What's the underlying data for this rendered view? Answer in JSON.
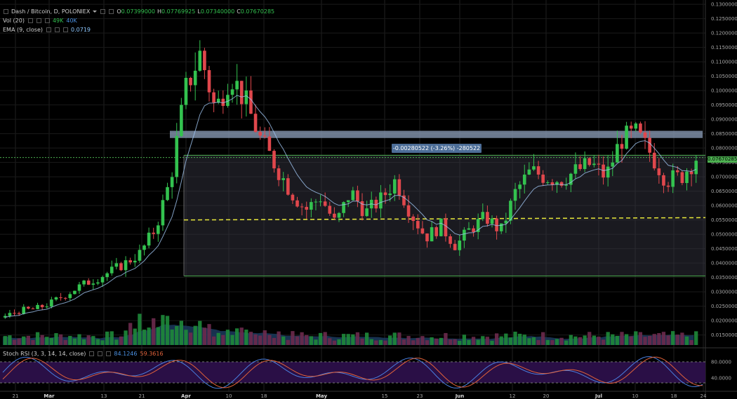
{
  "header": {
    "symbol": "Dash / Bitcoin, D, POLONIEX",
    "ohlc": [
      {
        "k": "O",
        "v": "0.07399000"
      },
      {
        "k": "H",
        "v": "0.07769925"
      },
      {
        "k": "L",
        "v": "0.07340000"
      },
      {
        "k": "C",
        "v": "0.07670285"
      }
    ]
  },
  "indicators": {
    "vol": {
      "label": "Vol (20)",
      "v1": "49K",
      "v2": "40K",
      "v1_color": "#33c24f",
      "v2_color": "#4a90e2"
    },
    "ema": {
      "label": "EMA (9, close)",
      "value": "0.0719"
    },
    "stoch": {
      "label": "Stoch RSI (3, 3, 14, 14, close)",
      "k": "84.1246",
      "d": "59.3616"
    }
  },
  "price_axis": {
    "labels": [
      "0.13000000",
      "0.12500000",
      "0.12000000",
      "0.11500000",
      "0.11000000",
      "0.10500000",
      "0.10000000",
      "0.09500000",
      "0.09000000",
      "0.08500000",
      "0.08000000",
      "0.07500000",
      "0.07000000",
      "0.06500000",
      "0.06000000",
      "0.05500000",
      "0.05000000",
      "0.04500000",
      "0.04000000",
      "0.03500000",
      "0.03000000",
      "0.02500000",
      "0.02000000",
      "0.01500000"
    ],
    "current_price": "0.07670285"
  },
  "rsi_axis": {
    "labels": [
      "80.0000",
      "40.0000"
    ]
  },
  "time_axis": {
    "labels": [
      {
        "t": "21",
        "bold": false
      },
      {
        "t": "Mar",
        "bold": true
      },
      {
        "t": "13",
        "bold": false
      },
      {
        "t": "21",
        "bold": false
      },
      {
        "t": "Apr",
        "bold": true
      },
      {
        "t": "10",
        "bold": false
      },
      {
        "t": "18",
        "bold": false
      },
      {
        "t": "May",
        "bold": true
      },
      {
        "t": "15",
        "bold": false
      },
      {
        "t": "23",
        "bold": false
      },
      {
        "t": "Jun",
        "bold": true
      },
      {
        "t": "12",
        "bold": false
      },
      {
        "t": "20",
        "bold": false
      },
      {
        "t": "Jul",
        "bold": true
      },
      {
        "t": "10",
        "bold": false
      },
      {
        "t": "18",
        "bold": false
      },
      {
        "t": "24",
        "bold": false
      }
    ]
  },
  "measurement": {
    "text": "-0.00280522 (-3.26%) -280522"
  },
  "colors": {
    "up": "#33c24f",
    "down": "#e0474c",
    "ema": "#9fc4f0",
    "rsi_k": "#4a7fe0",
    "rsi_d": "#e2623a",
    "rsi_band": "#2a0f46",
    "support": "#e8e83a",
    "box": "#4caf50"
  },
  "chart_data": {
    "type": "candlestick",
    "instrument": "Dash / Bitcoin, D, POLONIEX",
    "ylim": [
      0.012,
      0.131
    ],
    "close_path": [
      0.0215,
      0.0235,
      0.024,
      0.026,
      0.029,
      0.032,
      0.0345,
      0.037,
      0.04,
      0.0435,
      0.052,
      0.069,
      0.1,
      0.113,
      0.093,
      0.106,
      0.096,
      0.083,
      0.074,
      0.065,
      0.0585,
      0.063,
      0.0535,
      0.065,
      0.0575,
      0.062,
      0.069,
      0.0575,
      0.049,
      0.053,
      0.046,
      0.052,
      0.056,
      0.051,
      0.065,
      0.072,
      0.07,
      0.069,
      0.072,
      0.0745,
      0.07,
      0.083,
      0.085,
      0.078,
      0.069,
      0.07,
      0.0767
    ],
    "resistance_band": [
      0.0835,
      0.086
    ],
    "range_box": [
      0.0355,
      0.0775
    ],
    "support_line": 0.0555,
    "current": 0.07670285,
    "volume_scale": "relative",
    "stoch_rsi": {
      "k_last": 84.1246,
      "d_last": 59.3616,
      "bands": [
        80,
        20
      ]
    }
  }
}
